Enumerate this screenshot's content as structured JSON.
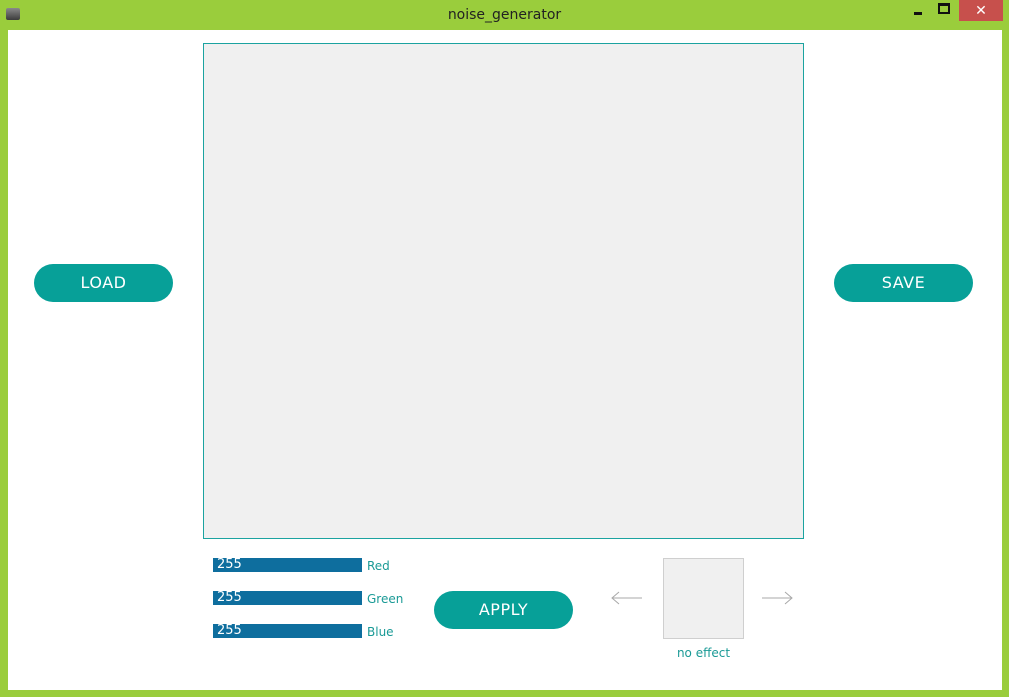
{
  "window": {
    "title": "noise_generator",
    "close_glyph": "✕",
    "frame_color": "#9acd3c",
    "close_color": "#c7504c"
  },
  "buttons": {
    "load": "LOAD",
    "save": "SAVE",
    "apply": "APPLY",
    "accent_color": "#07a098"
  },
  "sliders": [
    {
      "value": "255",
      "label": "Red"
    },
    {
      "value": "255",
      "label": "Green"
    },
    {
      "value": "255",
      "label": "Blue"
    }
  ],
  "effect": {
    "name": "no effect",
    "prev_icon": "arrow-left-icon",
    "next_icon": "arrow-right-icon"
  },
  "colors": {
    "slider_fill": "#0e6e9e",
    "label_text": "#1a9a96",
    "canvas_border": "#1ba3a0"
  }
}
